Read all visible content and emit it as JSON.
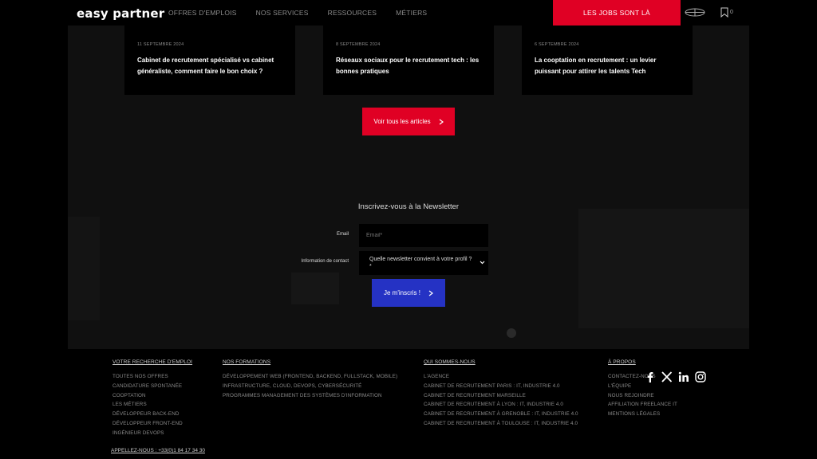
{
  "header": {
    "logo": "easy partner",
    "nav": [
      "OFFRES D'EMPLOIS",
      "NOS SERVICES",
      "RESSOURCES",
      "MÉTIERS"
    ],
    "jobs_button": "LES JOBS SONT LÀ",
    "bookmark_count": "0"
  },
  "articles": [
    {
      "date": "11 SEPTEMBRE 2024",
      "title": "Cabinet de recrutement spécialisé vs cabinet généraliste, comment faire le bon choix ?"
    },
    {
      "date": "8 SEPTEMBRE 2024",
      "title": "Réseaux sociaux pour le recrutement tech : les bonnes pratiques"
    },
    {
      "date": "6 SEPTEMBRE 2024",
      "title": "La cooptation en recrutement : un levier puissant pour attirer les talents Tech"
    }
  ],
  "all_articles_button": "Voir tous les articles",
  "newsletter": {
    "title": "Inscrivez-vous à la Newsletter",
    "email_label": "Email",
    "email_placeholder": "Email*",
    "contact_label": "Information de contact",
    "select_value": "Quelle newsletter convient à votre profil ?*",
    "submit": "Je m'inscris !"
  },
  "footer": {
    "col1": {
      "head": "VOTRE RECHERCHE D'EMPLOI",
      "items": [
        "TOUTES NOS OFFRES",
        "CANDIDATURE SPONTANÉE",
        "COOPTATION",
        "LES MÉTIERS",
        "DÉVELOPPEUR BACK-END",
        "DÉVELOPPEUR FRONT-END",
        "INGÉNIEUR DEVOPS"
      ]
    },
    "col2": {
      "head": "NOS FORMATIONS",
      "items": [
        "DÉVELOPPEMENT WEB (FRONTEND, BACKEND, FULLSTACK, MOBILE)",
        "INFRASTRUCTURE, CLOUD, DEVOPS, CYBERSÉCURITÉ",
        "PROGRAMMES MANAGEMENT DES SYSTÈMES D'INFORMATION"
      ]
    },
    "col3": {
      "head": "QUI SOMMES-NOUS",
      "items": [
        "L'AGENCE",
        "CABINET DE RECRUTEMENT PARIS : IT, INDUSTRIE 4.0",
        "CABINET DE RECRUTEMENT MARSEILLE",
        "CABINET DE RECRUTEMENT À LYON : IT, INDUSTRIE 4.0",
        "CABINET DE RECRUTEMENT À GRENOBLE : IT, INDUSTRIE 4.0",
        "CABINET DE RECRUTEMENT À TOULOUSE : IT, INDUSTRIE 4.0"
      ]
    },
    "col4": {
      "head": "À PROPOS",
      "items": [
        "CONTACTEZ-NOUS",
        "L'ÉQUIPE",
        "NOUS REJOINDRE",
        "AFFILIATION FREELANCE IT",
        "MENTIONS LÉGALES"
      ]
    },
    "phone": "APPELLEZ-NOUS : +33(0)1 84 17 34 30",
    "social": [
      "facebook-icon",
      "x-icon",
      "linkedin-icon",
      "instagram-icon"
    ]
  },
  "colors": {
    "accent_red": "#e00024",
    "accent_blue": "#2532c4",
    "background": "#000000",
    "panel": "#101010"
  }
}
